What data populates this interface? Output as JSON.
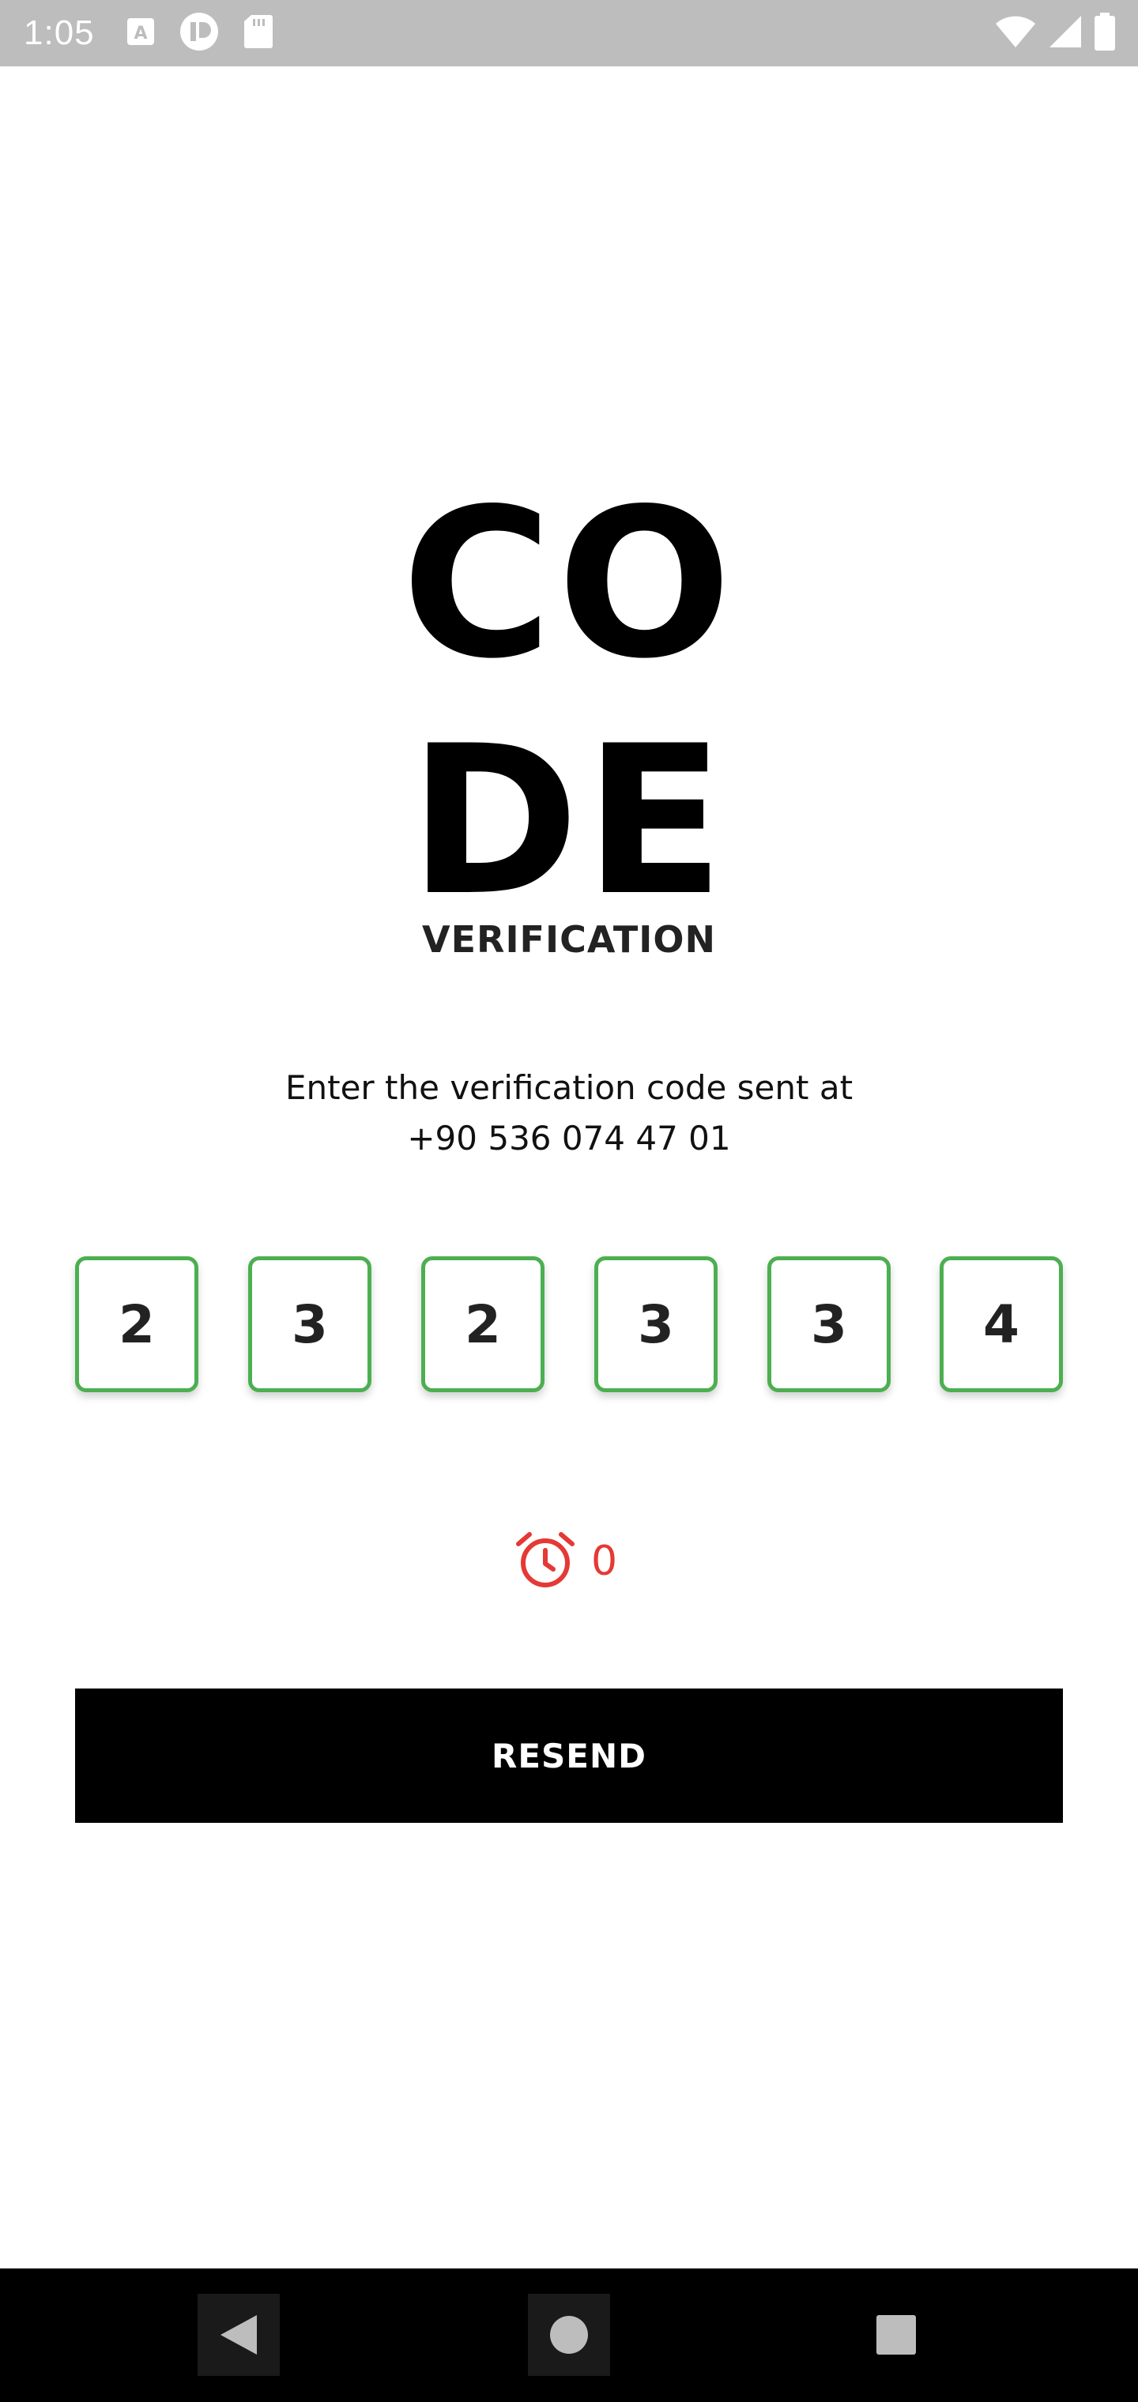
{
  "status_bar": {
    "time": "1:05",
    "icons_left": [
      "font-a-icon",
      "app-icon",
      "sd-card-icon"
    ],
    "icons_right": [
      "wifi-icon",
      "signal-icon",
      "battery-icon"
    ]
  },
  "title": {
    "line1": "CO",
    "line2": "DE"
  },
  "subtitle": "VERIFICATION",
  "description": {
    "line1": "Enter the verification code sent at",
    "line2": "+90 536 074 47 01"
  },
  "code_digits": [
    "2",
    "3",
    "2",
    "3",
    "3",
    "4"
  ],
  "timer": {
    "icon": "alarm-clock-icon",
    "value": "0"
  },
  "resend_label": "RESEND",
  "nav_bar": {
    "icons": [
      "back-icon",
      "home-icon",
      "recents-icon"
    ]
  },
  "colors": {
    "status_bar_bg": "#bdbdbd",
    "code_border": "#4caf50",
    "timer": "#e53935",
    "button_bg": "#000000",
    "button_text": "#ffffff"
  }
}
